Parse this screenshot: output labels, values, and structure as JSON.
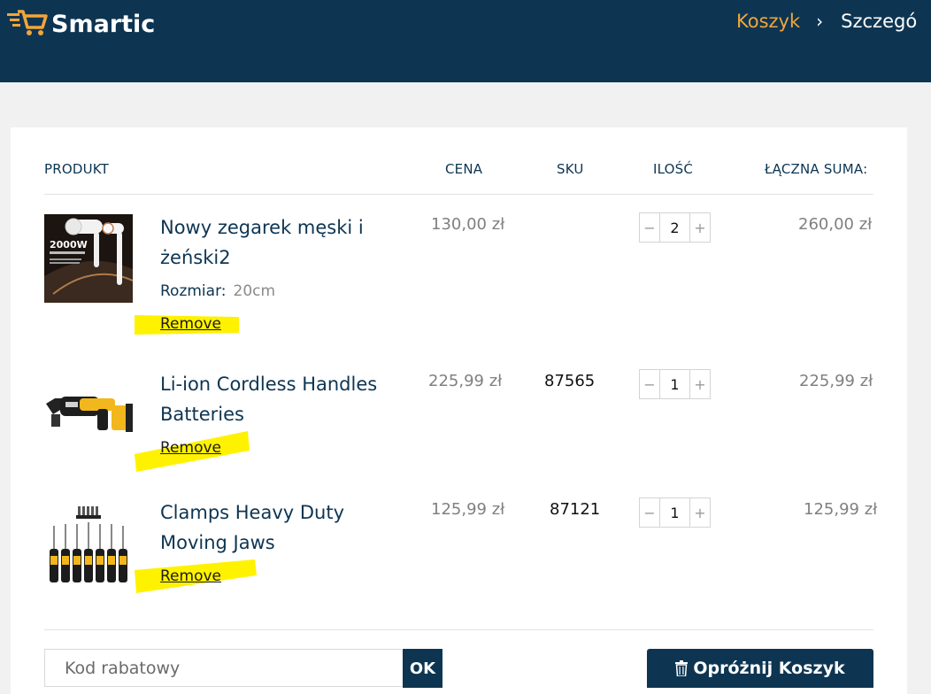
{
  "header": {
    "brand": "Smartic",
    "breadcrumb": {
      "current": "Koszyk",
      "separator": "›",
      "next": "Szczegó"
    }
  },
  "colors": {
    "primary": "#0d3552",
    "accent": "#f2a53a",
    "highlight": "#fff200"
  },
  "table": {
    "columns": {
      "product": "PRODUKT",
      "price": "CENA",
      "sku": "SKU",
      "qty": "ILOŚĆ",
      "total": "ŁĄCZNA SUMA:"
    }
  },
  "items": [
    {
      "name": "Nowy zegarek męski i żeński2",
      "attr_label": "Rozmiar:",
      "attr_value": "20cm",
      "remove": "Remove",
      "price": "130,00 zł",
      "sku": "",
      "qty": "2",
      "total": "260,00 zł",
      "thumb_icon": "hair-dryer-image",
      "thumb_text": "2000W"
    },
    {
      "name": "Li-ion Cordless Handles Batteries",
      "remove": "Remove",
      "price": "225,99 zł",
      "sku": "87565",
      "qty": "1",
      "total": "225,99 zł",
      "thumb_icon": "cordless-drill-image"
    },
    {
      "name": "Clamps Heavy Duty Moving Jaws",
      "remove": "Remove",
      "price": "125,99 zł",
      "sku": "87121",
      "qty": "1",
      "total": "125,99 zł",
      "thumb_icon": "screwdriver-set-image"
    }
  ],
  "qty_controls": {
    "minus": "−",
    "plus": "+"
  },
  "coupon": {
    "placeholder": "Kod rabatowy",
    "submit": "OK"
  },
  "empty_cart": {
    "label": "Opróżnij Koszyk",
    "icon": "trash-icon"
  }
}
